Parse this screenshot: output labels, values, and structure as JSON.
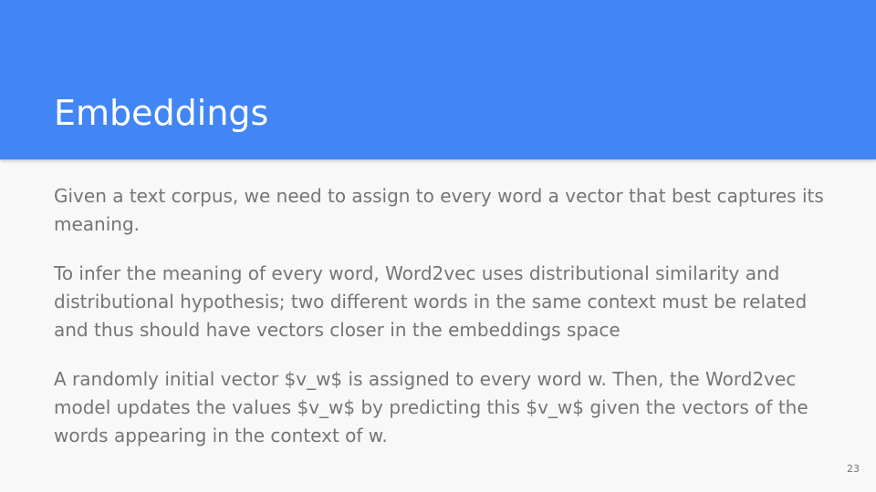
{
  "slide": {
    "title": "Embeddings",
    "paragraphs": [
      "Given a text corpus, we need to assign to every word a vector that best captures its meaning.",
      "To infer the meaning of every word, Word2vec uses distributional similarity and distributional hypothesis; two different words in the same context must be related and thus should have vectors closer in the embeddings space",
      "A randomly initial vector $v_w$ is assigned to every word w. Then, the Word2vec model updates the values $v_w$ by predicting this $v_w$ given the vectors of the words appearing in the context of w."
    ],
    "page_number": "23"
  },
  "colors": {
    "header_background": "#4285f4",
    "slide_background": "#f8f8f8",
    "title_text": "#ffffff",
    "body_text": "#757575"
  }
}
